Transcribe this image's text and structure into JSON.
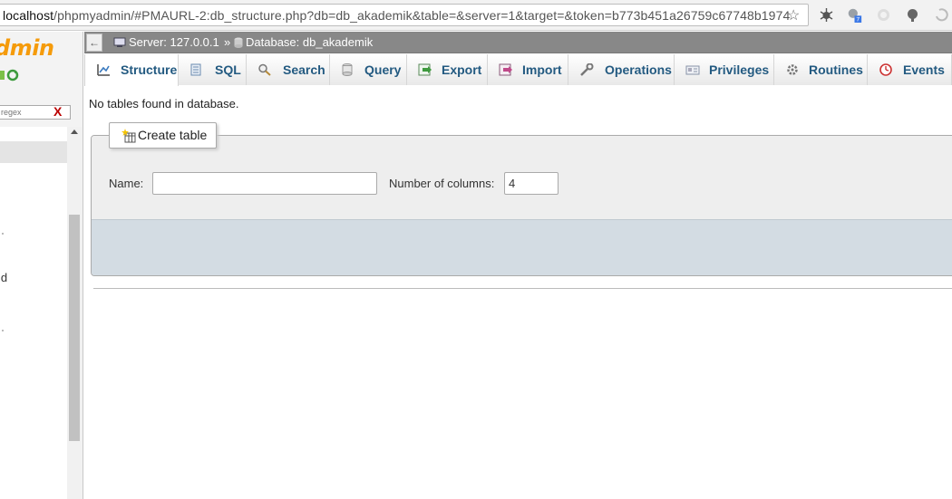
{
  "browser": {
    "url_host": "localhost",
    "url_path": "/phpmyadmin/#PMAURL-2:db_structure.php?db=db_akademik&table=&server=1&target=&token=b773b451a26759c67748b1974",
    "extension_badge": "7"
  },
  "nav": {
    "logo": "dmin",
    "filter_placeholder": "regex",
    "filter_clear": "X",
    "tree_text": "ld"
  },
  "breadcrumb": {
    "back": "←",
    "server": "Server: 127.0.0.1",
    "separator": "»",
    "database": "Database: db_akademik"
  },
  "tabs": [
    {
      "label": "Structure",
      "icon": "structure-icon",
      "active": true
    },
    {
      "label": "SQL",
      "icon": "sql-icon"
    },
    {
      "label": "Search",
      "icon": "search-icon"
    },
    {
      "label": "Query",
      "icon": "query-icon"
    },
    {
      "label": "Export",
      "icon": "export-icon"
    },
    {
      "label": "Import",
      "icon": "import-icon"
    },
    {
      "label": "Operations",
      "icon": "operations-icon"
    },
    {
      "label": "Privileges",
      "icon": "privileges-icon"
    },
    {
      "label": "Routines",
      "icon": "routines-icon"
    },
    {
      "label": "Events",
      "icon": "events-icon"
    }
  ],
  "main": {
    "message": "No tables found in database.",
    "create_table": {
      "legend": "Create table",
      "name_label": "Name:",
      "name_value": "",
      "columns_label": "Number of columns:",
      "columns_value": "4"
    }
  },
  "colors": {
    "tab_text": "#235a81",
    "breadcrumb_bg": "#888888",
    "logo": "#f59b0b",
    "fieldset_footer": "#d3dce3"
  }
}
